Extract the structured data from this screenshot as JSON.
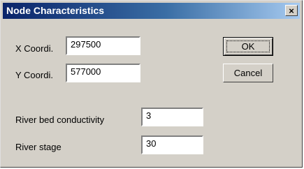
{
  "window": {
    "title": "Node Characteristics",
    "close_glyph": "×"
  },
  "fields": {
    "x_coord": {
      "label": "X Coordi.",
      "value": "297500"
    },
    "y_coord": {
      "label": "Y Coordi.",
      "value": "577000"
    },
    "river_bed_conductivity": {
      "label": "River bed conductivity",
      "value": "3"
    },
    "river_stage": {
      "label": "River stage",
      "value": "30"
    }
  },
  "buttons": {
    "ok_label": "OK",
    "cancel_label": "Cancel"
  },
  "colors": {
    "dialog_face": "#d4d0c8",
    "title_active": "#0a246a",
    "title_gradient_end": "#a6caf0",
    "title_text": "#ffffff"
  },
  "icons": {
    "close": "close-icon"
  }
}
